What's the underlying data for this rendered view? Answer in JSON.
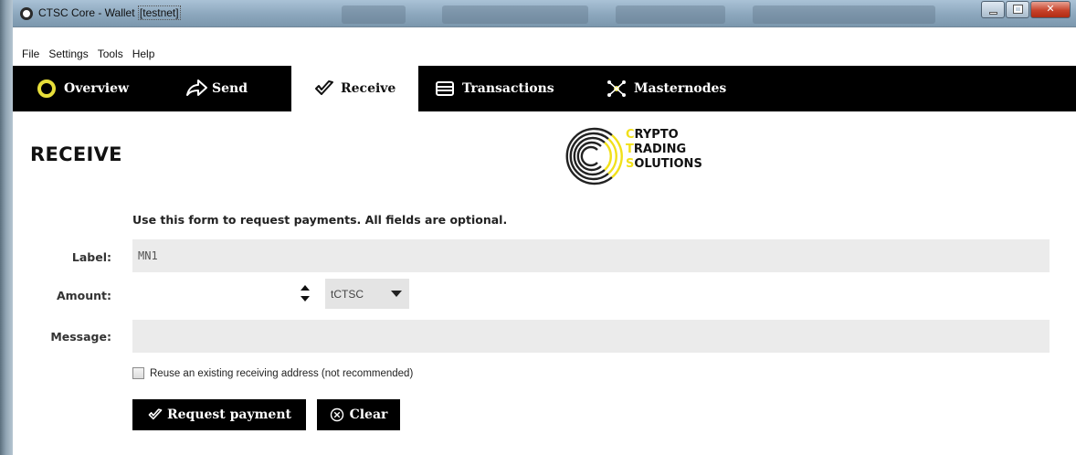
{
  "window": {
    "title_prefix": "CTSC Core - Wallet ",
    "title_network": "[testnet]"
  },
  "menu": {
    "items": [
      "File",
      "Settings",
      "Tools",
      "Help"
    ]
  },
  "nav": {
    "tabs": [
      {
        "label": "Overview",
        "icon": "ring-icon",
        "active": false
      },
      {
        "label": "Send",
        "icon": "send-arrow-icon",
        "active": false
      },
      {
        "label": "Receive",
        "icon": "receive-check-icon",
        "active": true
      },
      {
        "label": "Transactions",
        "icon": "list-icon",
        "active": false
      },
      {
        "label": "Masternodes",
        "icon": "nodes-icon",
        "active": false
      }
    ]
  },
  "page": {
    "title": "RECEIVE",
    "logo": {
      "line1_first": "C",
      "line1_rest": "RYPTO",
      "line2_first": "T",
      "line2_rest": "RADING",
      "line3_first": "S",
      "line3_rest": "OLUTIONS"
    },
    "intro": "Use this form to request payments. All fields are optional."
  },
  "form": {
    "label_label": "Label:",
    "label_value": "MN1",
    "amount_label": "Amount:",
    "amount_value": "",
    "unit": "tCTSC",
    "message_label": "Message:",
    "message_value": "",
    "reuse_label": "Reuse an existing receiving address (not recommended)"
  },
  "buttons": {
    "request": "Request payment",
    "clear": "Clear"
  },
  "colors": {
    "accent_yellow": "#f1e01a",
    "nav_bg": "#000000",
    "field_bg": "#ebebeb"
  }
}
